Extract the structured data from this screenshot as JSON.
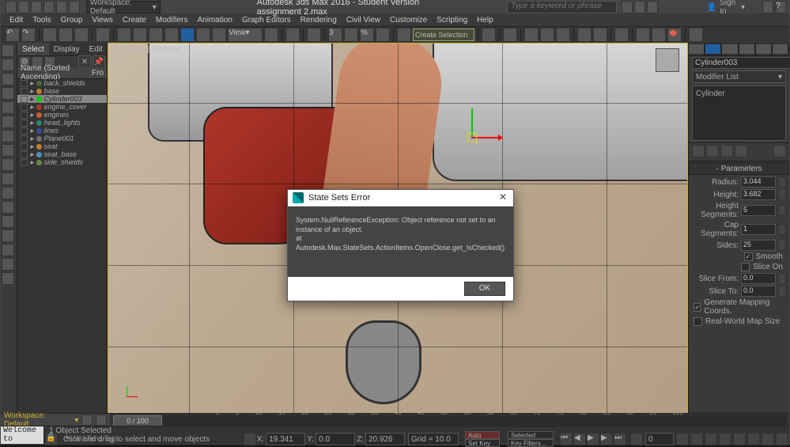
{
  "window": {
    "title": "Autodesk 3ds Max 2016 - Student Version     assignment 2.max",
    "minimize": "—",
    "maximize": "▢",
    "close": "✕"
  },
  "topbar": {
    "workspace_label": "Workspace: Default",
    "search_placeholder": "Type a keyword or phrase",
    "sign_in": "Sign In"
  },
  "menubar": [
    "Edit",
    "Tools",
    "Group",
    "Views",
    "Create",
    "Modifiers",
    "Animation",
    "Graph Editors",
    "Rendering",
    "Civil View",
    "Customize",
    "Scripting",
    "Help"
  ],
  "ribbon": {
    "create_selection": "Create Selection"
  },
  "scene_tabs": {
    "select": "Select",
    "display": "Display",
    "edit": "Edit"
  },
  "scene_header": "Name (Sorted Ascending)",
  "scene_header_col2": "Fro",
  "objects": [
    {
      "name": "back_shields",
      "color": "#4a6a3a"
    },
    {
      "name": "base",
      "color": "#c08030"
    },
    {
      "name": "Cylinder003",
      "color": "#00cc00",
      "selected": true
    },
    {
      "name": "engine_cover",
      "color": "#b0352a"
    },
    {
      "name": "engines",
      "color": "#cc6030"
    },
    {
      "name": "head_lights",
      "color": "#308866"
    },
    {
      "name": "lines",
      "color": "#3050a0"
    },
    {
      "name": "Plane001",
      "color": "#707070"
    },
    {
      "name": "seat",
      "color": "#c08030"
    },
    {
      "name": "seat_base",
      "color": "#5090c0"
    },
    {
      "name": "side_shields",
      "color": "#6a8a4a"
    }
  ],
  "viewport": {
    "label": "[+] [Front ] [Shaded ]"
  },
  "modify": {
    "obj_name": "Cylinder003",
    "modlist_label": "Modifier List",
    "stack_item": "Cylinder",
    "rollout": "Parameters",
    "radius_l": "Radius:",
    "radius_v": "3.044",
    "height_l": "Height:",
    "height_v": "3.682",
    "hseg_l": "Height Segments:",
    "hseg_v": "5",
    "cseg_l": "Cap Segments:",
    "cseg_v": "1",
    "sides_l": "Sides:",
    "sides_v": "25",
    "smooth": "Smooth",
    "sliceon": "Slice On",
    "sfrom_l": "Slice From:",
    "sfrom_v": "0.0",
    "sto_l": "Slice To:",
    "sto_v": "0.0",
    "genmap": "Generate Mapping Coords.",
    "realworld": "Real-World Map Size"
  },
  "dialog": {
    "title": "State Sets Error",
    "body1": "System.NullReferenceException: Object reference not set to an instance of an object.",
    "body2": "   at Autodesk.Max.StateSets.ActionItems.OpenClose.get_IsChecked()",
    "ok": "OK"
  },
  "timeline": {
    "workspace": "Workspace: Default",
    "slider": "0 / 100",
    "ticks": [
      "0",
      "5",
      "10",
      "15",
      "20",
      "25",
      "30",
      "35",
      "40",
      "45",
      "50",
      "55",
      "60",
      "65",
      "70",
      "75",
      "80",
      "85",
      "90",
      "95",
      "100"
    ]
  },
  "status": {
    "welcome": "Welcome to",
    "selcount": "1 Object Selected",
    "msg": "Click and drag to select and move objects",
    "x": "X:",
    "xv": "19.341",
    "y": "Y:",
    "yv": "0.0",
    "z": "Z:",
    "zv": "20.926",
    "grid": "Grid = 10.0",
    "auto": "Auto",
    "setk": "Set Key",
    "selected": "Selected",
    "keyf": "Key Filters...",
    "addtag": "Add Time Tag"
  }
}
